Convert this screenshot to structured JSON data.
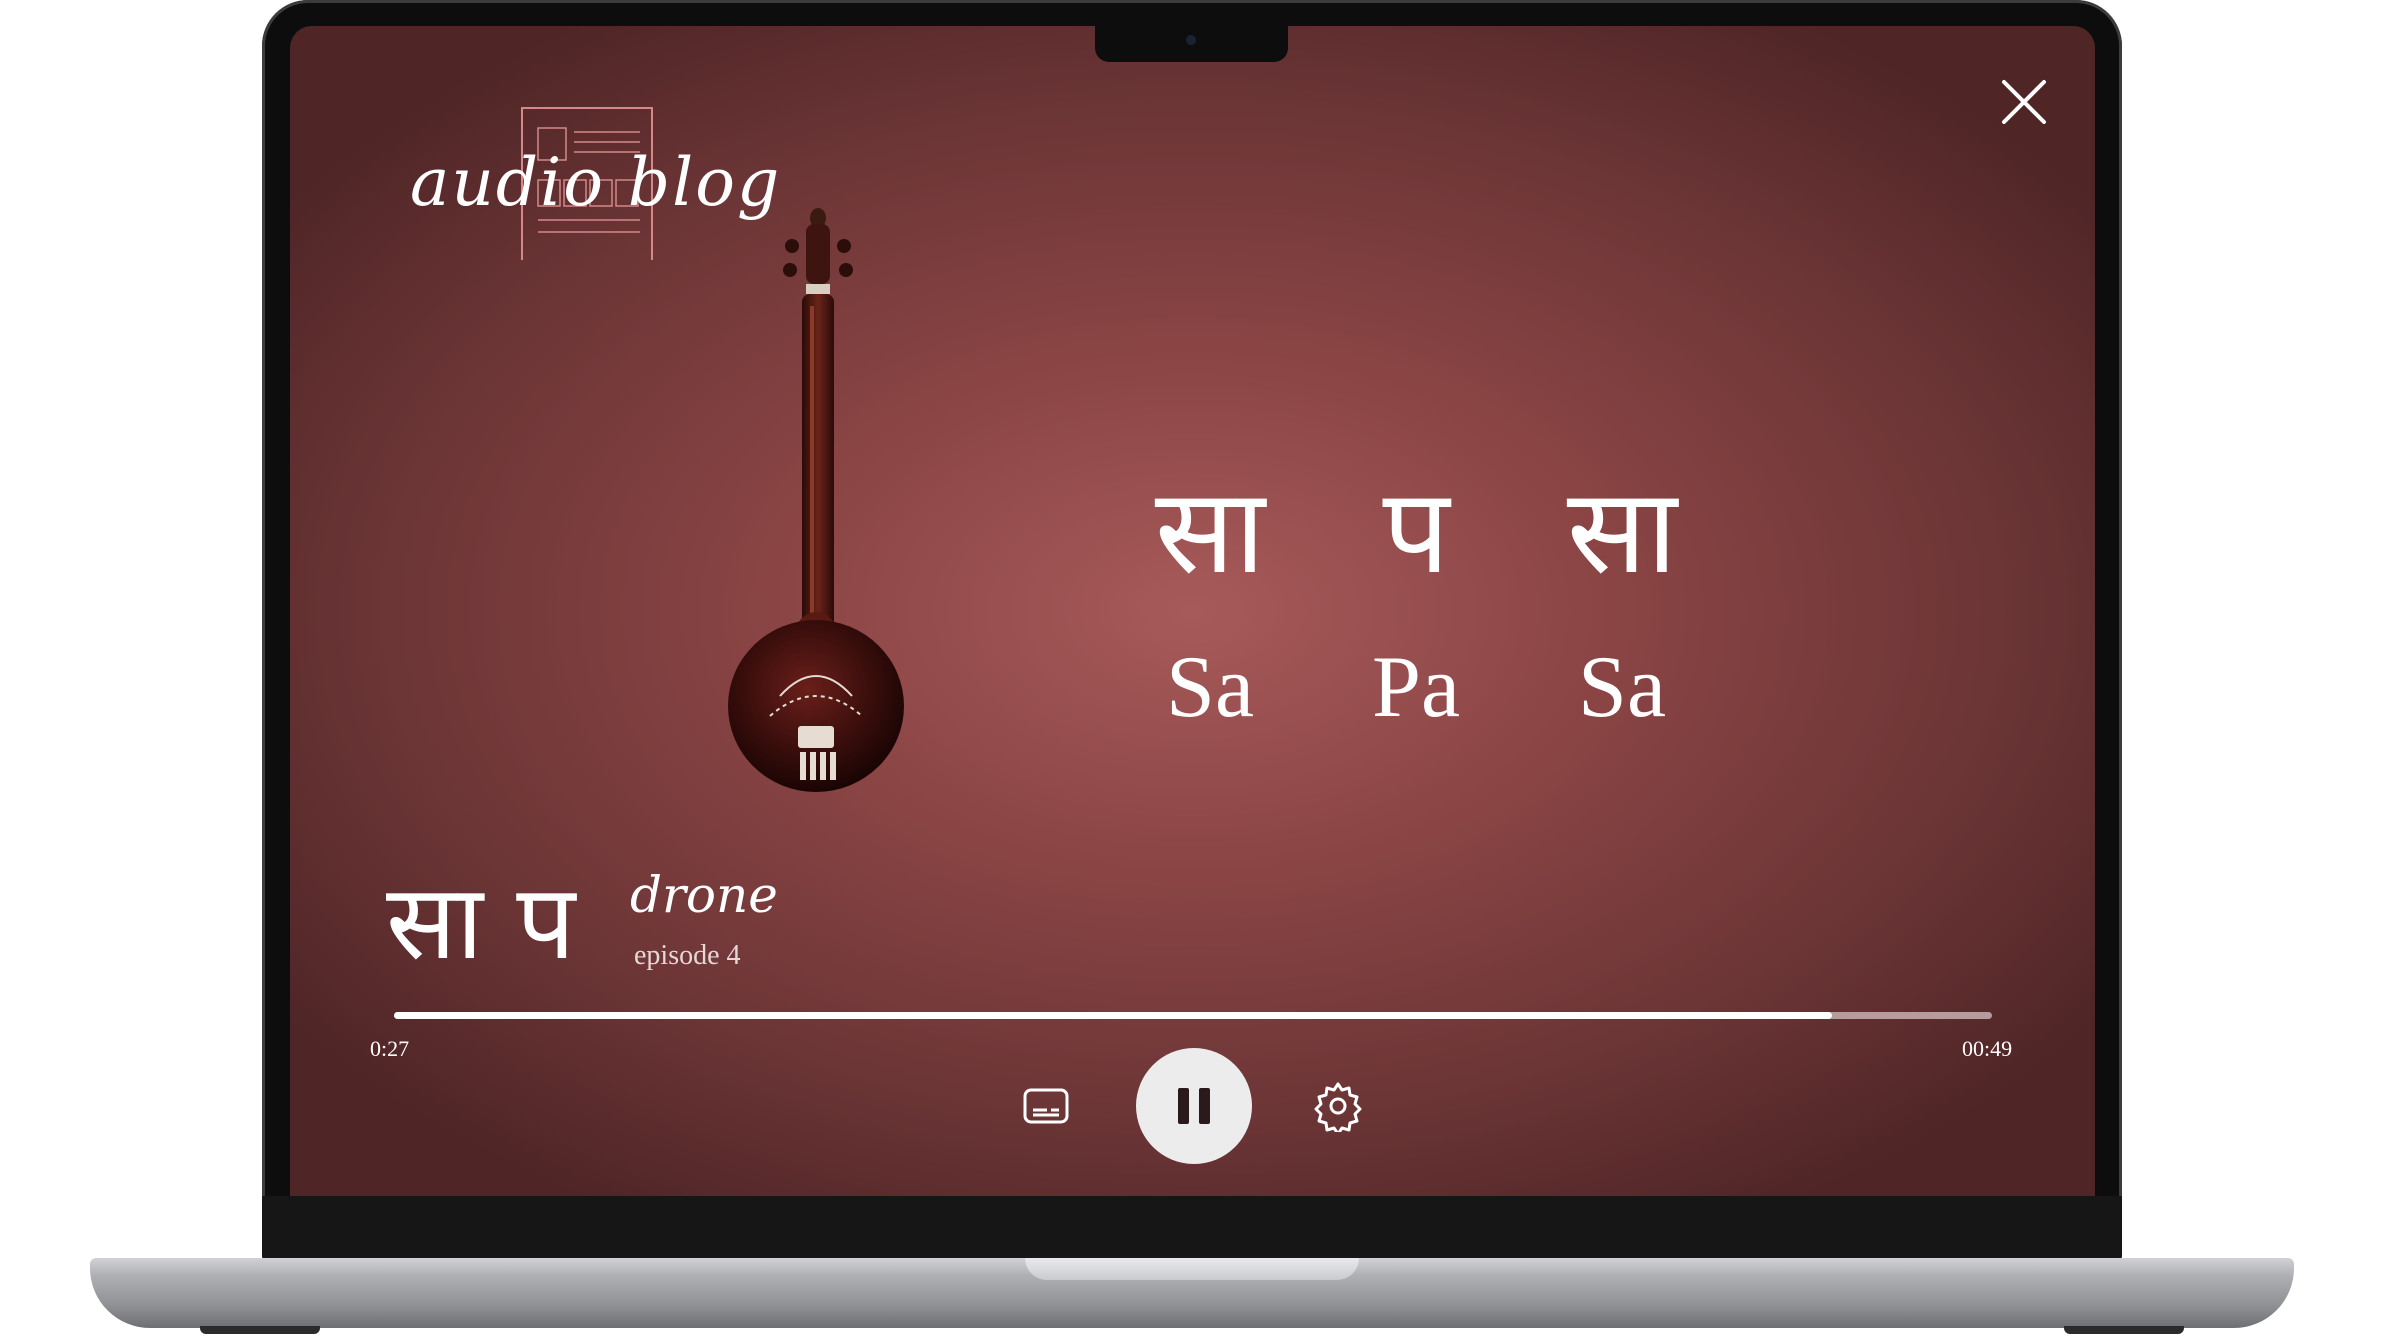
{
  "player": {
    "logo_text": "audio blog",
    "close_label": "close",
    "notes_devanagari": [
      "सा",
      "प",
      "सा"
    ],
    "notes_roman": [
      "Sa",
      "Pa",
      "Sa"
    ],
    "title_devanagari": "सा प",
    "title": "drone",
    "episode": "episode 4",
    "time_current": "0:27",
    "time_total": "00:49",
    "progress_fraction": 0.9,
    "controls": {
      "captions_icon": "captions-icon",
      "pause_icon": "pause-icon",
      "settings_icon": "gear-icon"
    }
  },
  "colors": {
    "background_center": "#a75a5a",
    "background_edge": "#4f2526",
    "text": "#ffffff"
  }
}
